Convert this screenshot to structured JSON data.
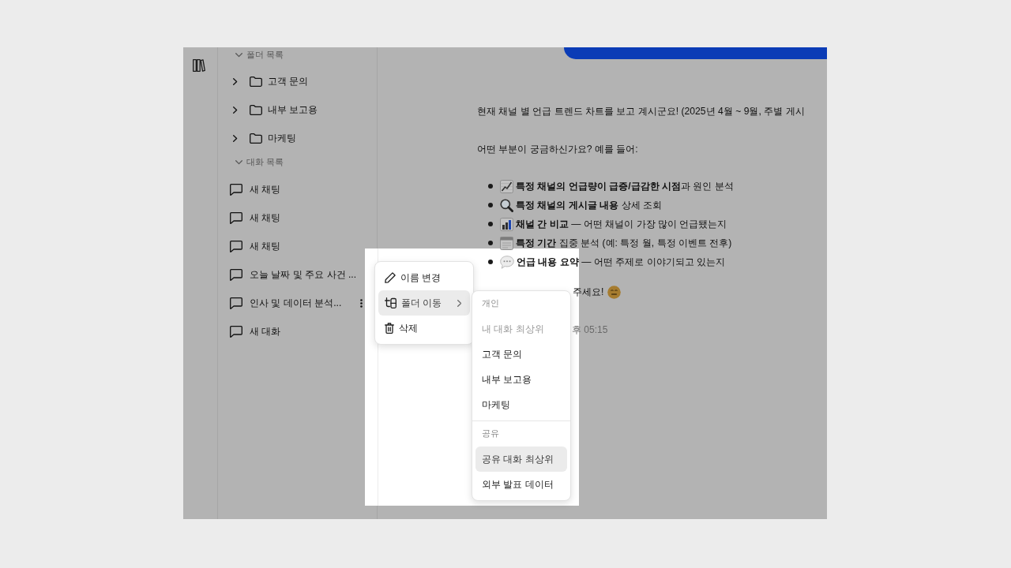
{
  "sidebar": {
    "sections": [
      {
        "title": "폴더 목록",
        "expanded": true,
        "kind": "folders",
        "items": [
          {
            "label": "고객 문의",
            "expanded": false
          },
          {
            "label": "내부 보고용",
            "expanded": false
          },
          {
            "label": "마케팅",
            "expanded": false
          }
        ]
      },
      {
        "title": "대화 목록",
        "expanded": true,
        "kind": "chats",
        "items": [
          {
            "label": "새 채팅",
            "active": false
          },
          {
            "label": "새 채팅",
            "active": false
          },
          {
            "label": "새 채팅",
            "active": false
          },
          {
            "label": "오늘 날짜 및 주요 사건 ...",
            "active": false
          },
          {
            "label": "인사 및 데이터 분석...",
            "active": true
          },
          {
            "label": "새 대화",
            "active": false
          }
        ]
      }
    ]
  },
  "chat": {
    "paragraphs": [
      "현재 채널 별 언급 트렌드 차트를 보고 계시군요! (2025년 4월 ~ 9월, 주별 게시",
      "어떤 부분이 궁금하신가요? 예를 들어:"
    ],
    "bullets": [
      {
        "kind": "trend",
        "text": "**특정 채널의 언급량이 급증/급감한 시점**과 원인 분석"
      },
      {
        "kind": "search",
        "text": "**특정 채널의 게시글 내용** 상세 조회"
      },
      {
        "kind": "bars",
        "text": "**채널 간 비교** — 어떤 채널이 가장 많이 언급됐는지"
      },
      {
        "kind": "calendar",
        "text": "**특정 기간** 집중 분석 (예: 특정 월, 특정 이벤트 전후)"
      },
      {
        "kind": "speech",
        "text": "**언급 내용 요약** — 어떤 주제로 이야기되고 있는지"
      }
    ],
    "closing": "주세요!",
    "timestamp": "후 05:15"
  },
  "context_menu": {
    "items": [
      {
        "kind": "rename",
        "label": "이름 변경",
        "highlighted": false,
        "submenu": false
      },
      {
        "kind": "move",
        "label": "폴더 이동",
        "highlighted": true,
        "submenu": true
      },
      {
        "kind": "delete",
        "label": "삭제",
        "highlighted": false,
        "submenu": false
      }
    ]
  },
  "submenu": {
    "sections": [
      {
        "title": "개인",
        "items": [
          {
            "label": "내 대화 최상위",
            "disabled": true,
            "highlighted": false
          },
          {
            "label": "고객 문의",
            "disabled": false,
            "highlighted": false
          },
          {
            "label": "내부 보고용",
            "disabled": false,
            "highlighted": false
          },
          {
            "label": "마케팅",
            "disabled": false,
            "highlighted": false
          }
        ]
      },
      {
        "title": "공유",
        "items": [
          {
            "label": "공유 대화 최상위",
            "disabled": false,
            "highlighted": true
          },
          {
            "label": "외부 발표 데이터",
            "disabled": false,
            "highlighted": false
          }
        ]
      }
    ]
  }
}
